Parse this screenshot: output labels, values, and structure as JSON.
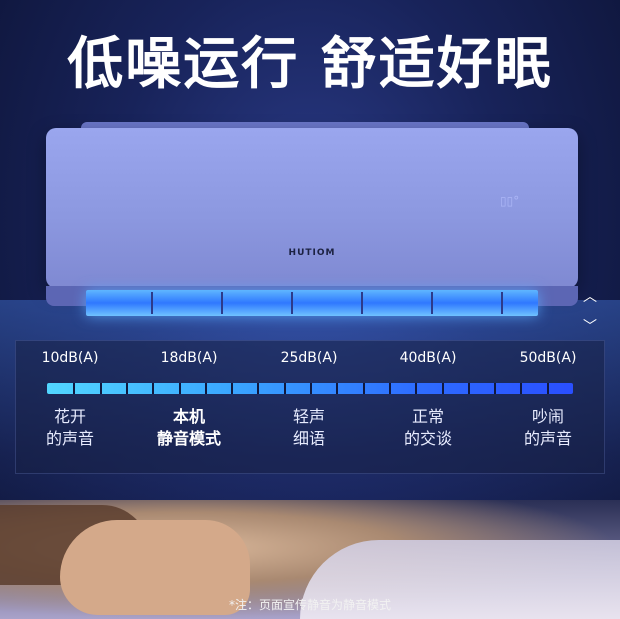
{
  "headline": "低噪运行 舒适好眠",
  "ac": {
    "brand": "HUTIOM"
  },
  "nav": {
    "up_icon": "chevron-up-icon",
    "down_icon": "chevron-down-icon"
  },
  "scale": {
    "levels": [
      "10dB(A)",
      "18dB(A)",
      "25dB(A)",
      "40dB(A)",
      "50dB(A)"
    ],
    "descriptions": [
      {
        "line1": "花开",
        "line2": "的声音"
      },
      {
        "line1": "本机",
        "line2": "静音模式"
      },
      {
        "line1": "轻声",
        "line2": "细语"
      },
      {
        "line1": "正常",
        "line2": "的交谈"
      },
      {
        "line1": "吵闹",
        "line2": "的声音"
      }
    ],
    "highlighted_index": 1
  },
  "footnote": "*注：页面宣传静音为静音模式",
  "colors": {
    "bar_start": "#52d6ff",
    "bar_end": "#2a4fff",
    "background": "#18235a"
  }
}
